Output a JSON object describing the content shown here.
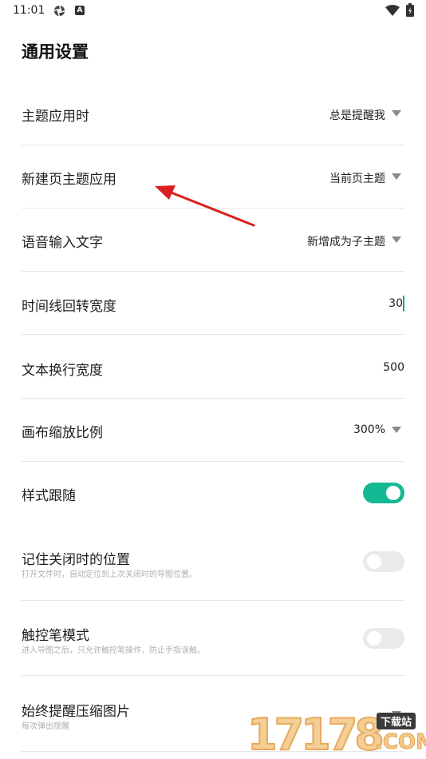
{
  "status_bar": {
    "time": "11:01",
    "icon_a": "aperture-icon",
    "icon_b_letter": "A",
    "wifi": "wifi-icon",
    "battery": "battery-charging-icon"
  },
  "title": "通用设置",
  "settings": [
    {
      "label": "主题应用时",
      "value": "总是提醒我",
      "control": "dropdown"
    },
    {
      "label": "新建页主题应用",
      "value": "当前页主题",
      "control": "dropdown"
    },
    {
      "label": "语音输入文字",
      "value": "新增成为子主题",
      "control": "dropdown"
    },
    {
      "label": "时间线回转宽度",
      "value": "30",
      "control": "text-input"
    },
    {
      "label": "文本换行宽度",
      "value": "500",
      "control": "text"
    },
    {
      "label": "画布缩放比例",
      "value": "300%",
      "control": "dropdown"
    },
    {
      "label": "样式跟随",
      "control": "toggle",
      "on": true
    },
    {
      "label": "记住关闭时的位置",
      "sub": "打开文件时，自动定位到上次关闭时的导图位置。",
      "control": "toggle",
      "on": false
    },
    {
      "label": "触控笔模式",
      "sub": "进入导图之后，只允许触控笔操作，防止手指误触。",
      "control": "toggle",
      "on": false
    },
    {
      "label": "始终提醒压缩图片",
      "sub": "每次弹出提醒",
      "control": "dropdown"
    }
  ],
  "colors": {
    "accent": "#14b893",
    "annotation_arrow": "#d9201e"
  },
  "watermark": {
    "digits": "17178",
    "tag": "下载站",
    "domain": ".COM"
  }
}
